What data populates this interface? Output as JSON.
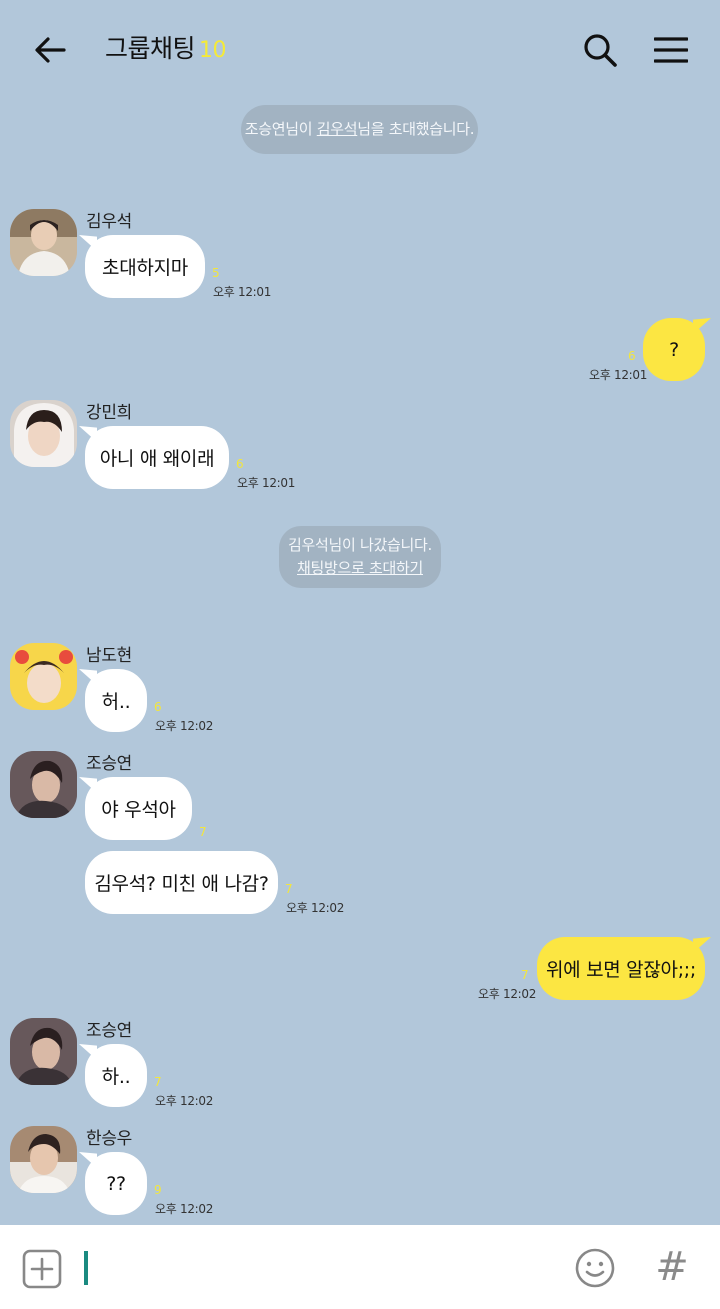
{
  "header": {
    "title": "그룹채팅",
    "member_count": "10",
    "icons": {
      "back": "back-arrow-icon",
      "search": "search-icon",
      "menu": "hamburger-menu-icon"
    }
  },
  "colors": {
    "background": "#b2c7da",
    "my_bubble": "#fce642",
    "other_bubble": "#ffffff",
    "unread_count": "#f3e63d",
    "notice_bg": "#a2b3c2"
  },
  "notices": [
    {
      "prefix": "조승연님이 ",
      "link": "김우석",
      "suffix": "님을 초대했습니다."
    },
    {
      "line1": "김우석님이 나갔습니다.",
      "link": "채팅방으로 초대하기"
    }
  ],
  "messages": [
    {
      "sender": "김우석",
      "text": "초대하지마",
      "unread": "5",
      "time": "오후 12:01"
    },
    {
      "sender": "me",
      "text": "?",
      "unread": "6",
      "time": "오후 12:01"
    },
    {
      "sender": "강민희",
      "text": "아니 애 왜이래",
      "unread": "6",
      "time": "오후 12:01"
    },
    {
      "sender": "남도현",
      "text": "허..",
      "unread": "6",
      "time": "오후 12:02"
    },
    {
      "sender": "조승연",
      "text": "야 우석아",
      "unread": "7",
      "time": ""
    },
    {
      "sender": "조승연",
      "text": "김우석? 미친 애 나감?",
      "unread": "7",
      "time": "오후 12:02"
    },
    {
      "sender": "me",
      "text": "위에 보면 알잖아;;;",
      "unread": "7",
      "time": "오후 12:02"
    },
    {
      "sender": "조승연",
      "text": "하..",
      "unread": "7",
      "time": "오후 12:02"
    },
    {
      "sender": "한승우",
      "text": "??",
      "unread": "9",
      "time": "오후 12:02"
    }
  ],
  "input": {
    "value": "",
    "icons": {
      "attach": "plus-square-icon",
      "emoji": "smiley-icon",
      "hashtag": "hashtag-icon"
    },
    "hash_glyph": "#"
  }
}
